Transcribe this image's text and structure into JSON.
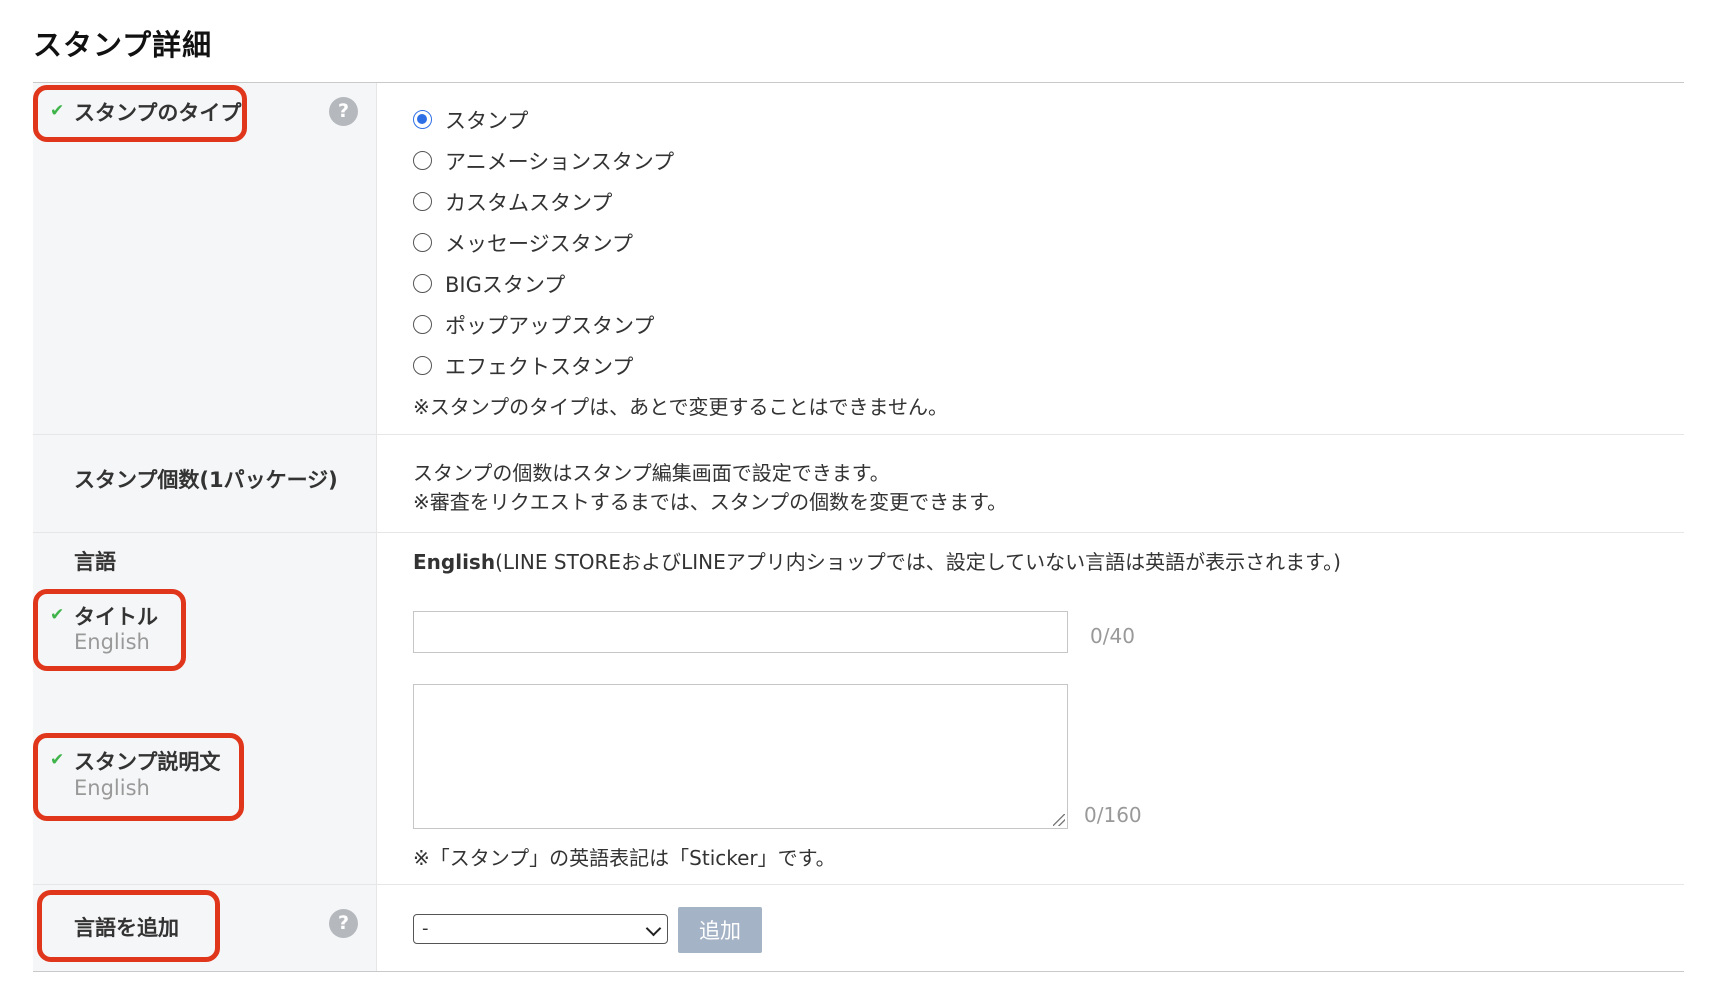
{
  "page_title": "スタンプ詳細",
  "check_mark": "✔",
  "help_glyph": "?",
  "sticker_type": {
    "label": "スタンプのタイプ",
    "options": [
      {
        "label": "スタンプ",
        "selected": true
      },
      {
        "label": "アニメーションスタンプ",
        "selected": false
      },
      {
        "label": "カスタムスタンプ",
        "selected": false
      },
      {
        "label": "メッセージスタンプ",
        "selected": false
      },
      {
        "label": "BIGスタンプ",
        "selected": false
      },
      {
        "label": "ポップアップスタンプ",
        "selected": false
      },
      {
        "label": "エフェクトスタンプ",
        "selected": false
      }
    ],
    "note": "※スタンプのタイプは、あとで変更することはできません。"
  },
  "sticker_count": {
    "label": "スタンプ個数(1パッケージ)",
    "line1": "スタンプの個数はスタンプ編集画面で設定できます。",
    "line2": "※審査をリクエストするまでは、スタンプの個数を変更できます。"
  },
  "language": {
    "label": "言語",
    "value": "English",
    "note": "(LINE STOREおよびLINEアプリ内ショップでは、設定していない言語は英語が表示されます。)"
  },
  "title_field": {
    "label": "タイトル",
    "sublabel": "English",
    "value": "",
    "counter": "0/40"
  },
  "description_field": {
    "label": "スタンプ説明文",
    "sublabel": "English",
    "value": "",
    "counter": "0/160",
    "note": "※「スタンプ」の英語表記は「Sticker」です。"
  },
  "add_language": {
    "label": "言語を追加",
    "selected_option": "-",
    "button_label": "追加"
  },
  "colors": {
    "highlight": "#e0361b",
    "check": "#3fb44b",
    "radio_selected": "#2f6fe6",
    "add_button_bg": "#a5b3c6"
  }
}
